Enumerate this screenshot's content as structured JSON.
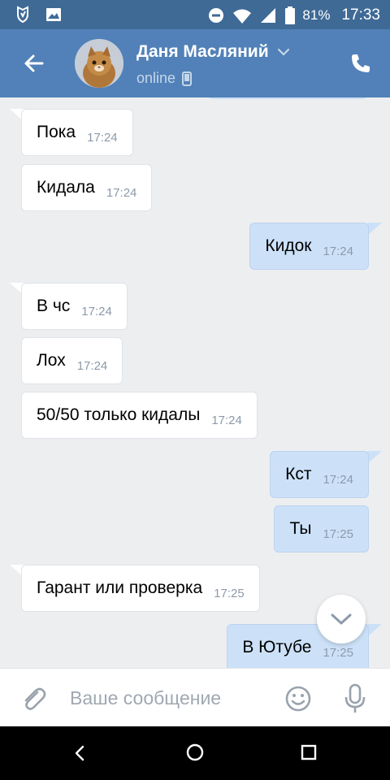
{
  "status_bar": {
    "battery": "81%",
    "time": "17:33",
    "icons": [
      "notification-icon",
      "gallery-icon",
      "dnd-icon",
      "wifi-icon",
      "signal-icon",
      "battery-icon"
    ]
  },
  "header": {
    "name": "Даня Масляний",
    "status": "online",
    "accent": "#5181b8",
    "status_bar_color": "#3f6a96"
  },
  "messages": [
    {
      "dir": "in",
      "text": "Пока",
      "time": "17:24"
    },
    {
      "dir": "in",
      "text": "Кидала",
      "time": "17:24"
    },
    {
      "dir": "out",
      "text": "Кидок",
      "time": "17:24"
    },
    {
      "dir": "in",
      "text": "В чс",
      "time": "17:24"
    },
    {
      "dir": "in",
      "text": "Лох",
      "time": "17:24"
    },
    {
      "dir": "in",
      "text": "50/50 только кидалы",
      "time": "17:24"
    },
    {
      "dir": "out",
      "text": "Кст",
      "time": "17:24"
    },
    {
      "dir": "out",
      "text": "Ты",
      "time": "17:25"
    },
    {
      "dir": "in",
      "text": "Гарант или проверка",
      "time": "17:25"
    },
    {
      "dir": "out",
      "text": "В Ютубе",
      "time": "17:25"
    }
  ],
  "composer": {
    "placeholder": "Ваше сообщение"
  },
  "colors": {
    "incoming_bubble": "#ffffff",
    "outgoing_bubble": "#cce1f8",
    "chat_background": "#edeef0"
  }
}
